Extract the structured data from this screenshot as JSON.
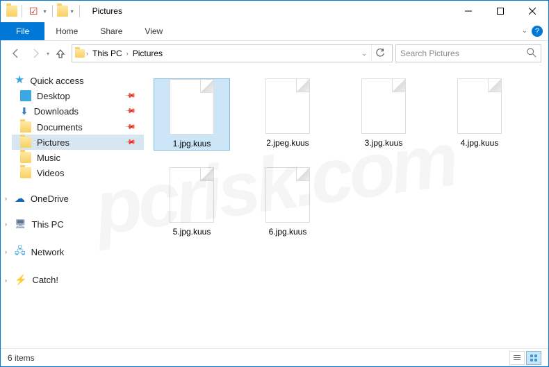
{
  "window": {
    "title": "Pictures"
  },
  "ribbon": {
    "file": "File",
    "tabs": [
      "Home",
      "Share",
      "View"
    ]
  },
  "breadcrumb": {
    "items": [
      "This PC",
      "Pictures"
    ],
    "refresh": "↻"
  },
  "search": {
    "placeholder": "Search Pictures"
  },
  "tree": {
    "quick_access": {
      "label": "Quick access",
      "items": [
        {
          "label": "Desktop",
          "pinned": true
        },
        {
          "label": "Downloads",
          "pinned": true
        },
        {
          "label": "Documents",
          "pinned": true
        },
        {
          "label": "Pictures",
          "pinned": true,
          "selected": true
        },
        {
          "label": "Music",
          "pinned": false
        },
        {
          "label": "Videos",
          "pinned": false
        }
      ]
    },
    "roots": [
      {
        "label": "OneDrive"
      },
      {
        "label": "This PC"
      },
      {
        "label": "Network"
      },
      {
        "label": "Catch!"
      }
    ]
  },
  "files": [
    {
      "name": "1.jpg.kuus",
      "selected": true
    },
    {
      "name": "2.jpeg.kuus",
      "selected": false
    },
    {
      "name": "3.jpg.kuus",
      "selected": false
    },
    {
      "name": "4.jpg.kuus",
      "selected": false
    },
    {
      "name": "5.jpg.kuus",
      "selected": false
    },
    {
      "name": "6.jpg.kuus",
      "selected": false
    }
  ],
  "status": {
    "count_text": "6 items"
  },
  "watermark": "pcrisk.com"
}
